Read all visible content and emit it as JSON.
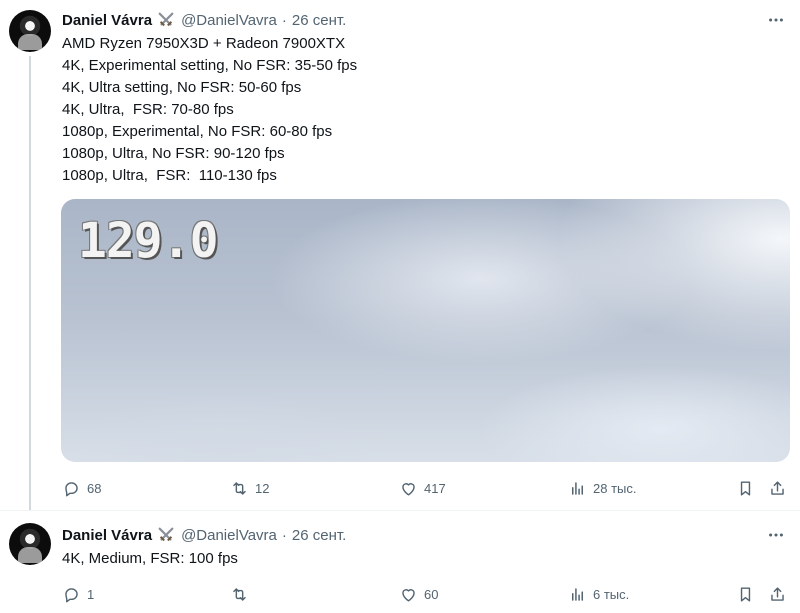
{
  "tweets": [
    {
      "author": {
        "name": "Daniel Vávra",
        "badge_icon": "crossed-swords-icon",
        "handle": "@DanielVavra",
        "separator": "·",
        "date": "26 сент."
      },
      "lines": [
        "AMD Ryzen 7950X3D + Radeon 7900XTX",
        "4K, Experimental setting, No FSR: 35-50 fps",
        "4K, Ultra setting, No FSR: 50-60 fps",
        "4K, Ultra,  FSR: 70-80 fps",
        "1080p, Experimental, No FSR: 60-80 fps",
        "1080p, Ultra, No FSR: 90-120 fps",
        "1080p, Ultra,  FSR:  110-130 fps"
      ],
      "media": {
        "fps_readout": "129.0"
      },
      "stats": {
        "replies": "68",
        "reposts": "12",
        "likes": "417",
        "views": "28 тыс."
      }
    },
    {
      "author": {
        "name": "Daniel Vávra",
        "badge_icon": "crossed-swords-icon",
        "handle": "@DanielVavra",
        "separator": "·",
        "date": "26 сент."
      },
      "lines": [
        "4K, Medium, FSR: 100 fps"
      ],
      "stats": {
        "replies": "1",
        "reposts": "",
        "likes": "60",
        "views": "6 тыс."
      }
    }
  ],
  "colors": {
    "text": "#0f1419",
    "muted": "#536471",
    "thread_line": "#cfd9de"
  }
}
